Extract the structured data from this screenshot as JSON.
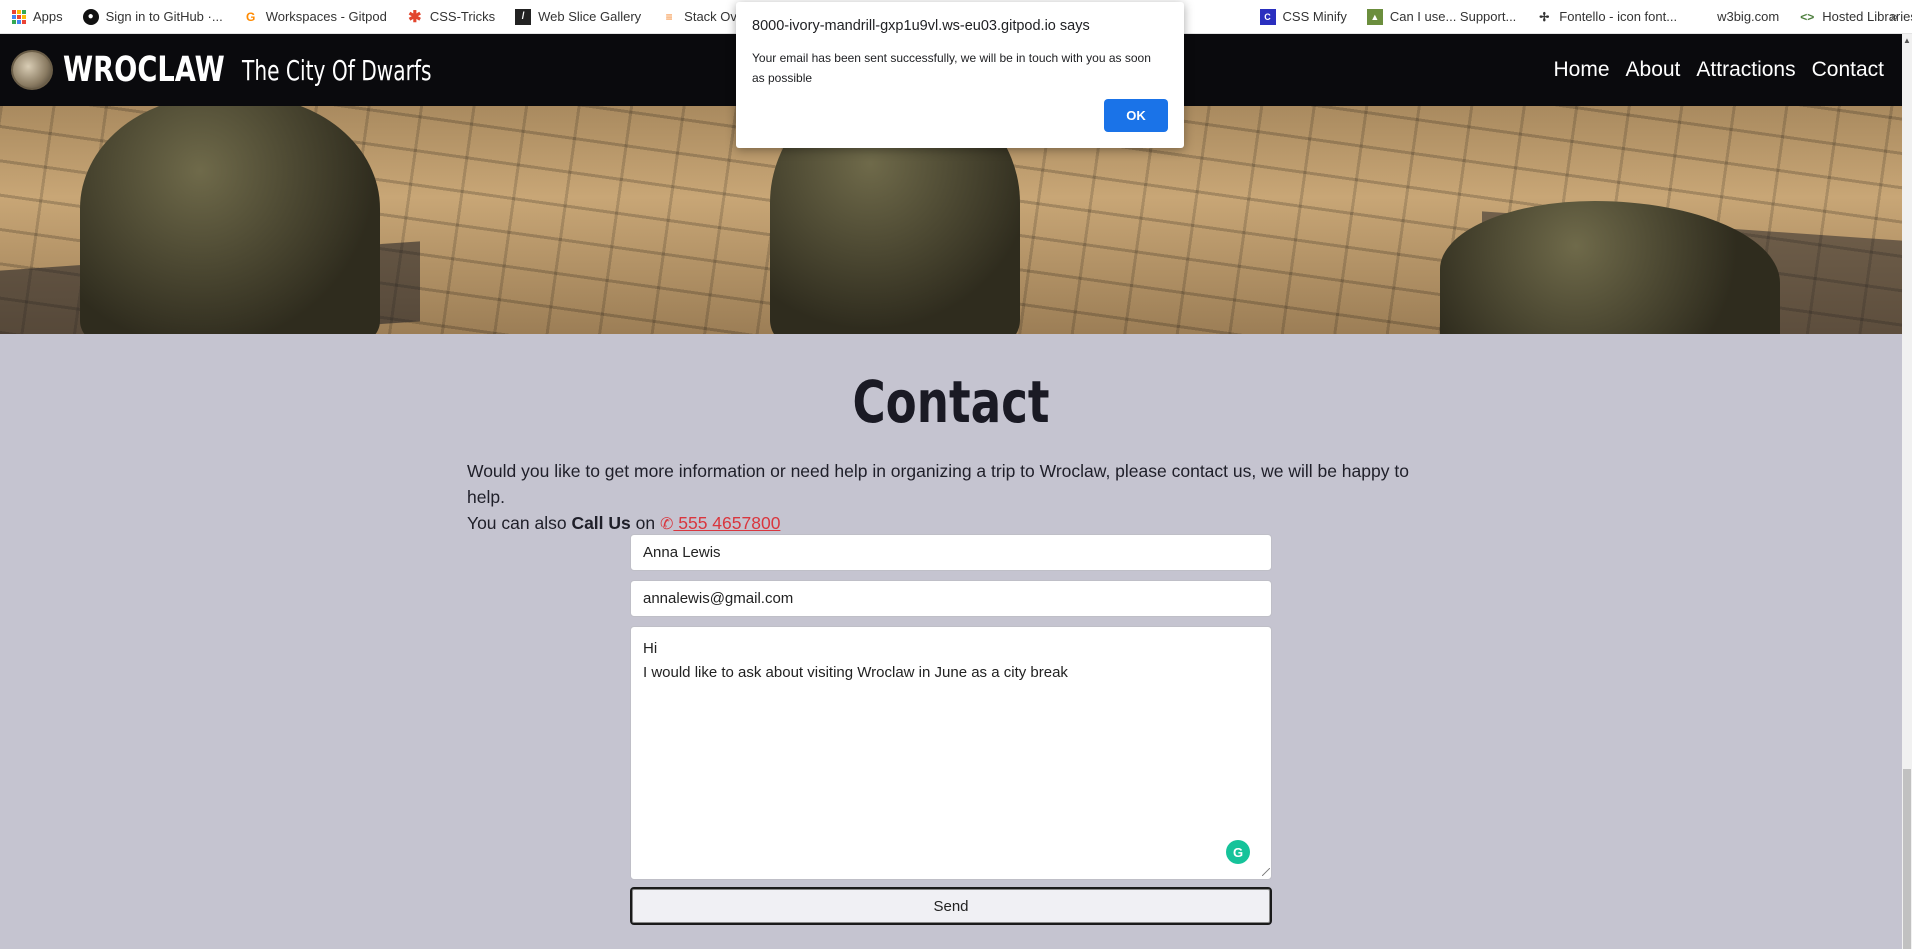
{
  "bookmarks": [
    {
      "label": "Apps",
      "icon": "apps-grid-icon"
    },
    {
      "label": "Sign in to GitHub ·...",
      "icon": "github-icon"
    },
    {
      "label": "Workspaces - Gitpod",
      "icon": "gitpod-icon"
    },
    {
      "label": "CSS-Tricks",
      "icon": "css-tricks-icon"
    },
    {
      "label": "Web Slice Gallery",
      "icon": "web-slice-icon"
    },
    {
      "label": "Stack Overflow - W...",
      "icon": "stackoverflow-icon"
    },
    {
      "label": "CSS Minify",
      "icon": "css-minify-icon"
    },
    {
      "label": "Can I use... Support...",
      "icon": "caniuse-icon"
    },
    {
      "label": "Fontello - icon font...",
      "icon": "fontello-icon"
    },
    {
      "label": "w3big.com",
      "icon": "w3big-icon"
    },
    {
      "label": "Hosted Libraries |...",
      "icon": "hosted-libraries-icon"
    }
  ],
  "bookmarks_more": "»",
  "header": {
    "brand": "WROCLAW",
    "tagline": "The City Of Dwarfs",
    "nav": [
      "Home",
      "About",
      "Attractions",
      "Contact"
    ]
  },
  "contact": {
    "title": "Contact",
    "intro_line1": "Would you like to get more information or need help in organizing a trip to Wroclaw, please contact us, we will be happy to help.",
    "intro_line2_prefix": "You can also ",
    "intro_line2_bold": "Call Us",
    "intro_line2_on": " on ",
    "phone": " 555 4657800",
    "name_value": "Anna Lewis",
    "email_value": "annalewis@gmail.com",
    "message_line1": "Hi",
    "message_line2": "I would like to ask about visiting Wroclaw in June as a city break",
    "send_label": "Send"
  },
  "dialog": {
    "title": "8000-ivory-mandrill-gxp1u9vl.ws-eu03.gitpod.io says",
    "message": "Your email has been sent successfully, we will be in touch with you as soon as possible",
    "ok_label": "OK"
  },
  "colors": {
    "accent_blue": "#1a73e8",
    "phone_red": "#d9363e",
    "header_bg": "#0a0a0d",
    "page_bg": "#c5c4d0"
  }
}
